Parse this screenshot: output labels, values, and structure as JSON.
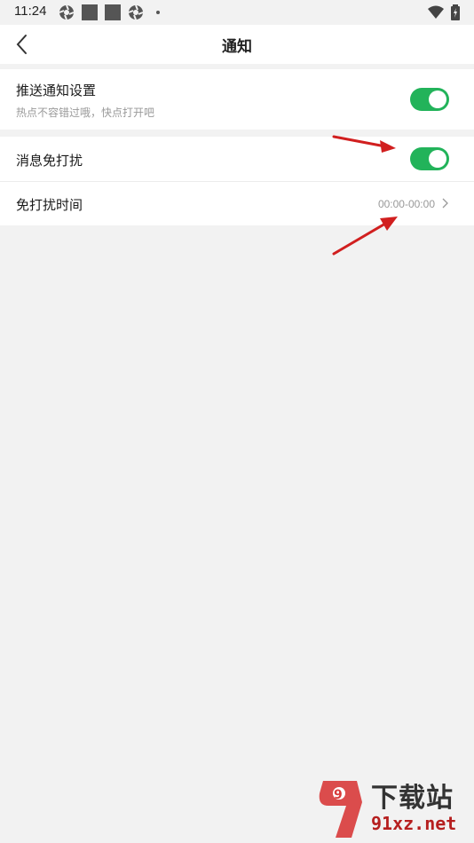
{
  "status_bar": {
    "time": "11:24"
  },
  "header": {
    "title": "通知"
  },
  "push_settings": {
    "title": "推送通知设置",
    "subtitle": "热点不容错过哦，快点打开吧",
    "enabled": true
  },
  "do_not_disturb": {
    "title": "消息免打扰",
    "enabled": true,
    "time_label": "免打扰时间",
    "time_value": "00:00-00:00"
  },
  "colors": {
    "accent": "#22b35a",
    "arrow": "#d11f1f"
  },
  "watermark": {
    "cn": "下载站",
    "en": "91xz.net",
    "logo": "9"
  }
}
